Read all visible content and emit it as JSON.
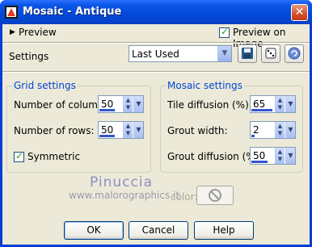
{
  "window": {
    "title": "Mosaic - Antique",
    "close_glyph": "✕"
  },
  "preview": {
    "label": "Preview",
    "arrow": "▶",
    "on_image_label": "Preview on Image",
    "on_image_checked": true
  },
  "settings": {
    "label": "Settings",
    "value": "Last Used"
  },
  "grid": {
    "title": "Grid settings",
    "columns_label": "Number of columns:",
    "columns_value": "50",
    "rows_label": "Number of rows:",
    "rows_value": "50",
    "symmetric_label": "Symmetric",
    "symmetric_checked": true
  },
  "mosaic": {
    "title": "Mosaic settings",
    "tile_diffusion_label": "Tile diffusion (%):",
    "tile_diffusion_value": "65",
    "grout_width_label": "Grout width:",
    "grout_width_value": "2",
    "grout_diffusion_label": "Grout diffusion (%):",
    "grout_diffusion_value": "50"
  },
  "edge": {
    "label": "color:"
  },
  "watermark": {
    "line1": "Pinuccia",
    "line2": "www.malorographics.it"
  },
  "buttons": {
    "ok": "OK",
    "cancel": "Cancel",
    "help": "Help"
  },
  "icons": [
    "app-icon",
    "save-icon",
    "randomize-icon",
    "reset-icon",
    "close-icon",
    "chevron-down-icon",
    "spin-up-icon",
    "spin-down-icon",
    "no-symbol-icon"
  ]
}
